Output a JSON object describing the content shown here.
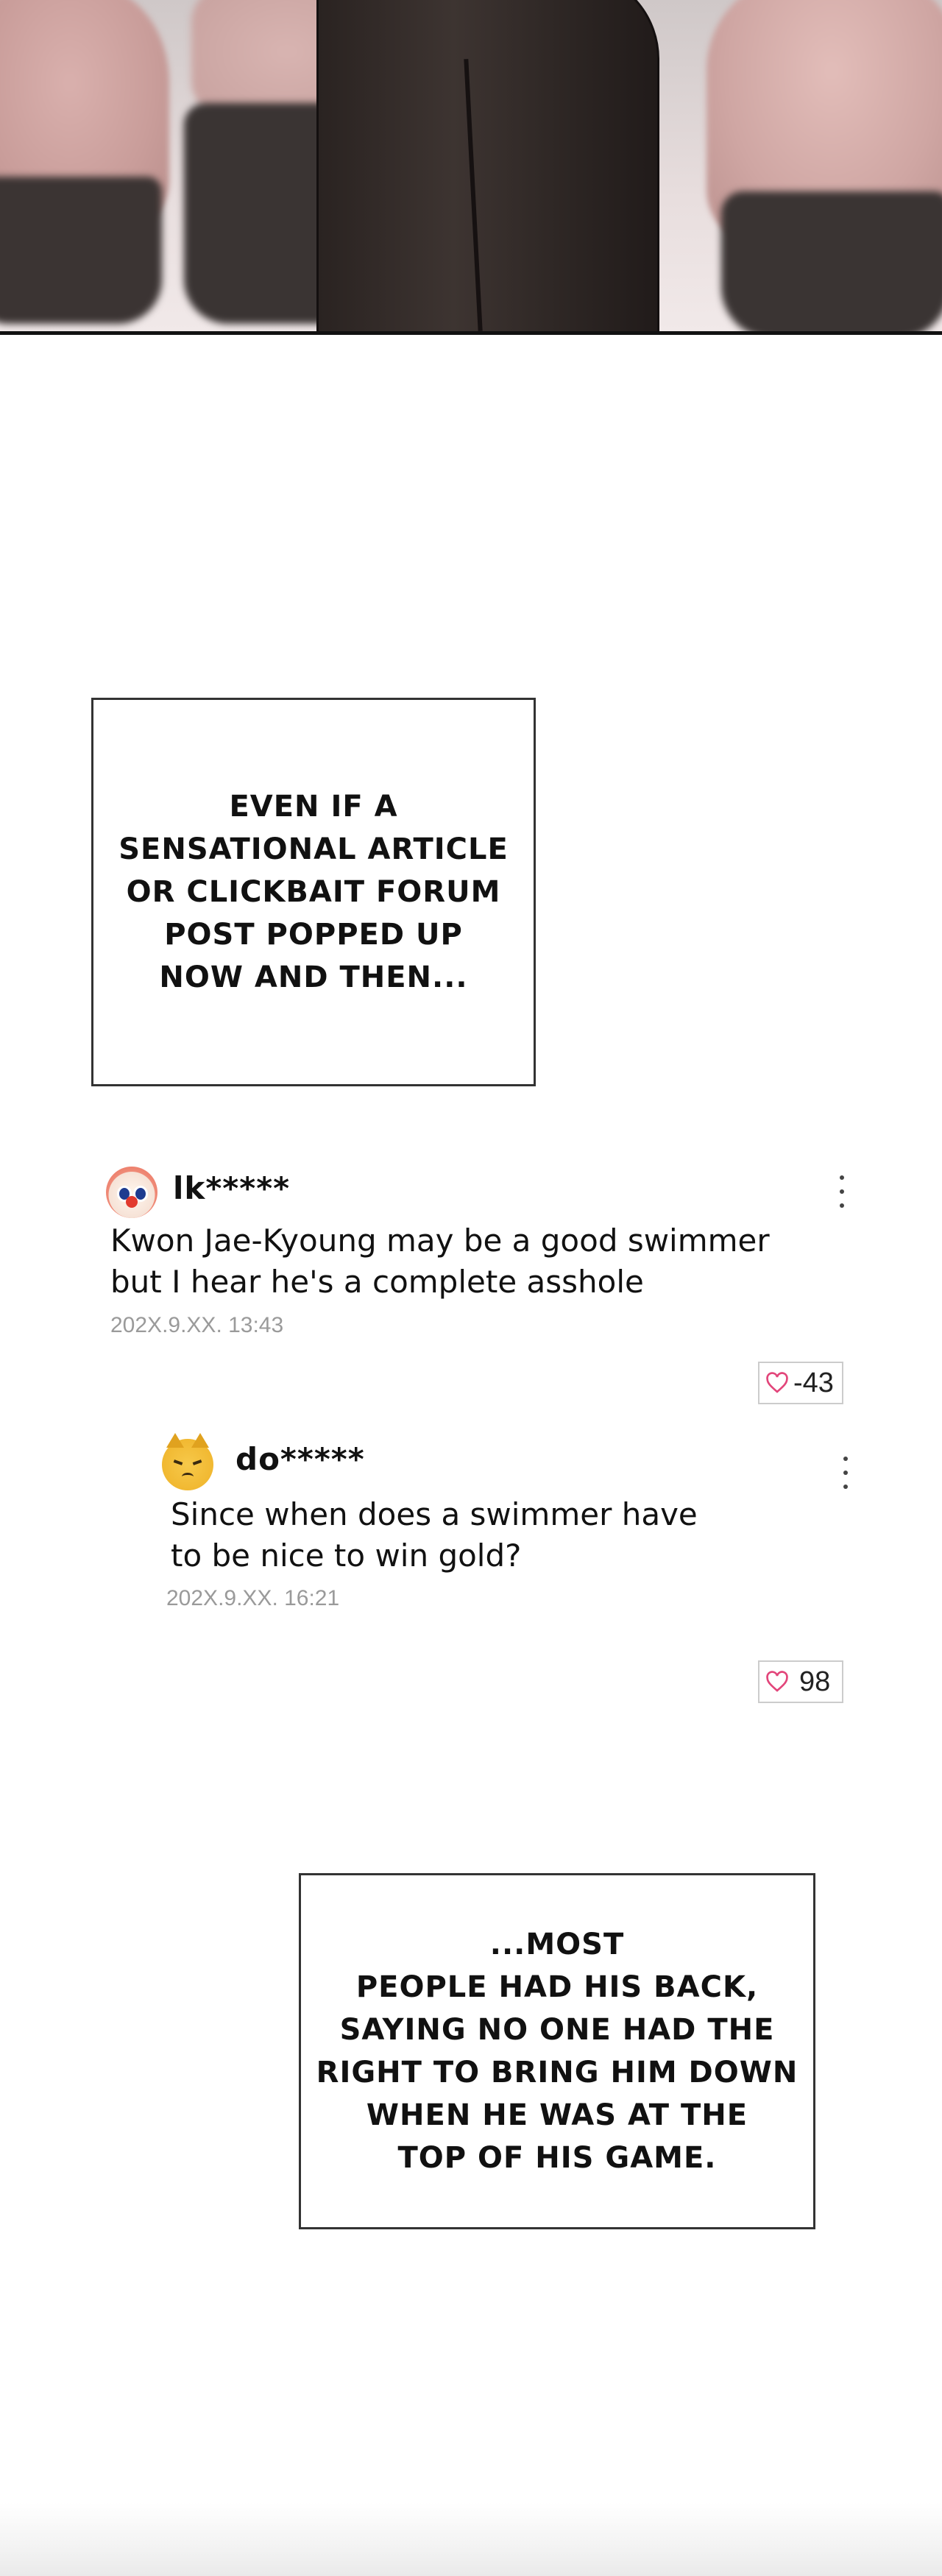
{
  "narrations": [
    "EVEN IF A\nSENSATIONAL ARTICLE\nOR CLICKBAIT FORUM\nPOST POPPED UP\nNOW AND THEN...",
    "...MOST\nPEOPLE HAD HIS BACK,\nSAYING NO ONE HAD THE\nRIGHT TO BRING HIM DOWN\nWHEN HE WAS AT THE\nTOP OF HIS GAME."
  ],
  "comments": [
    {
      "avatar_icon": "clown-face-icon",
      "username": "lk*****",
      "text": "Kwon Jae-Kyoung may be a good swimmer\nbut I hear he's a complete asshole",
      "timestamp": "202X.9.XX. 13:43",
      "likes": "-43"
    },
    {
      "avatar_icon": "pouting-cat-icon",
      "username": "do*****",
      "text": "Since when does a swimmer have\nto be nice to win gold?",
      "timestamp": "202X.9.XX. 16:21",
      "likes": "98"
    }
  ],
  "colors": {
    "heart": "#e2457a",
    "timestamp": "#9a9a9a",
    "border": "#333333"
  }
}
